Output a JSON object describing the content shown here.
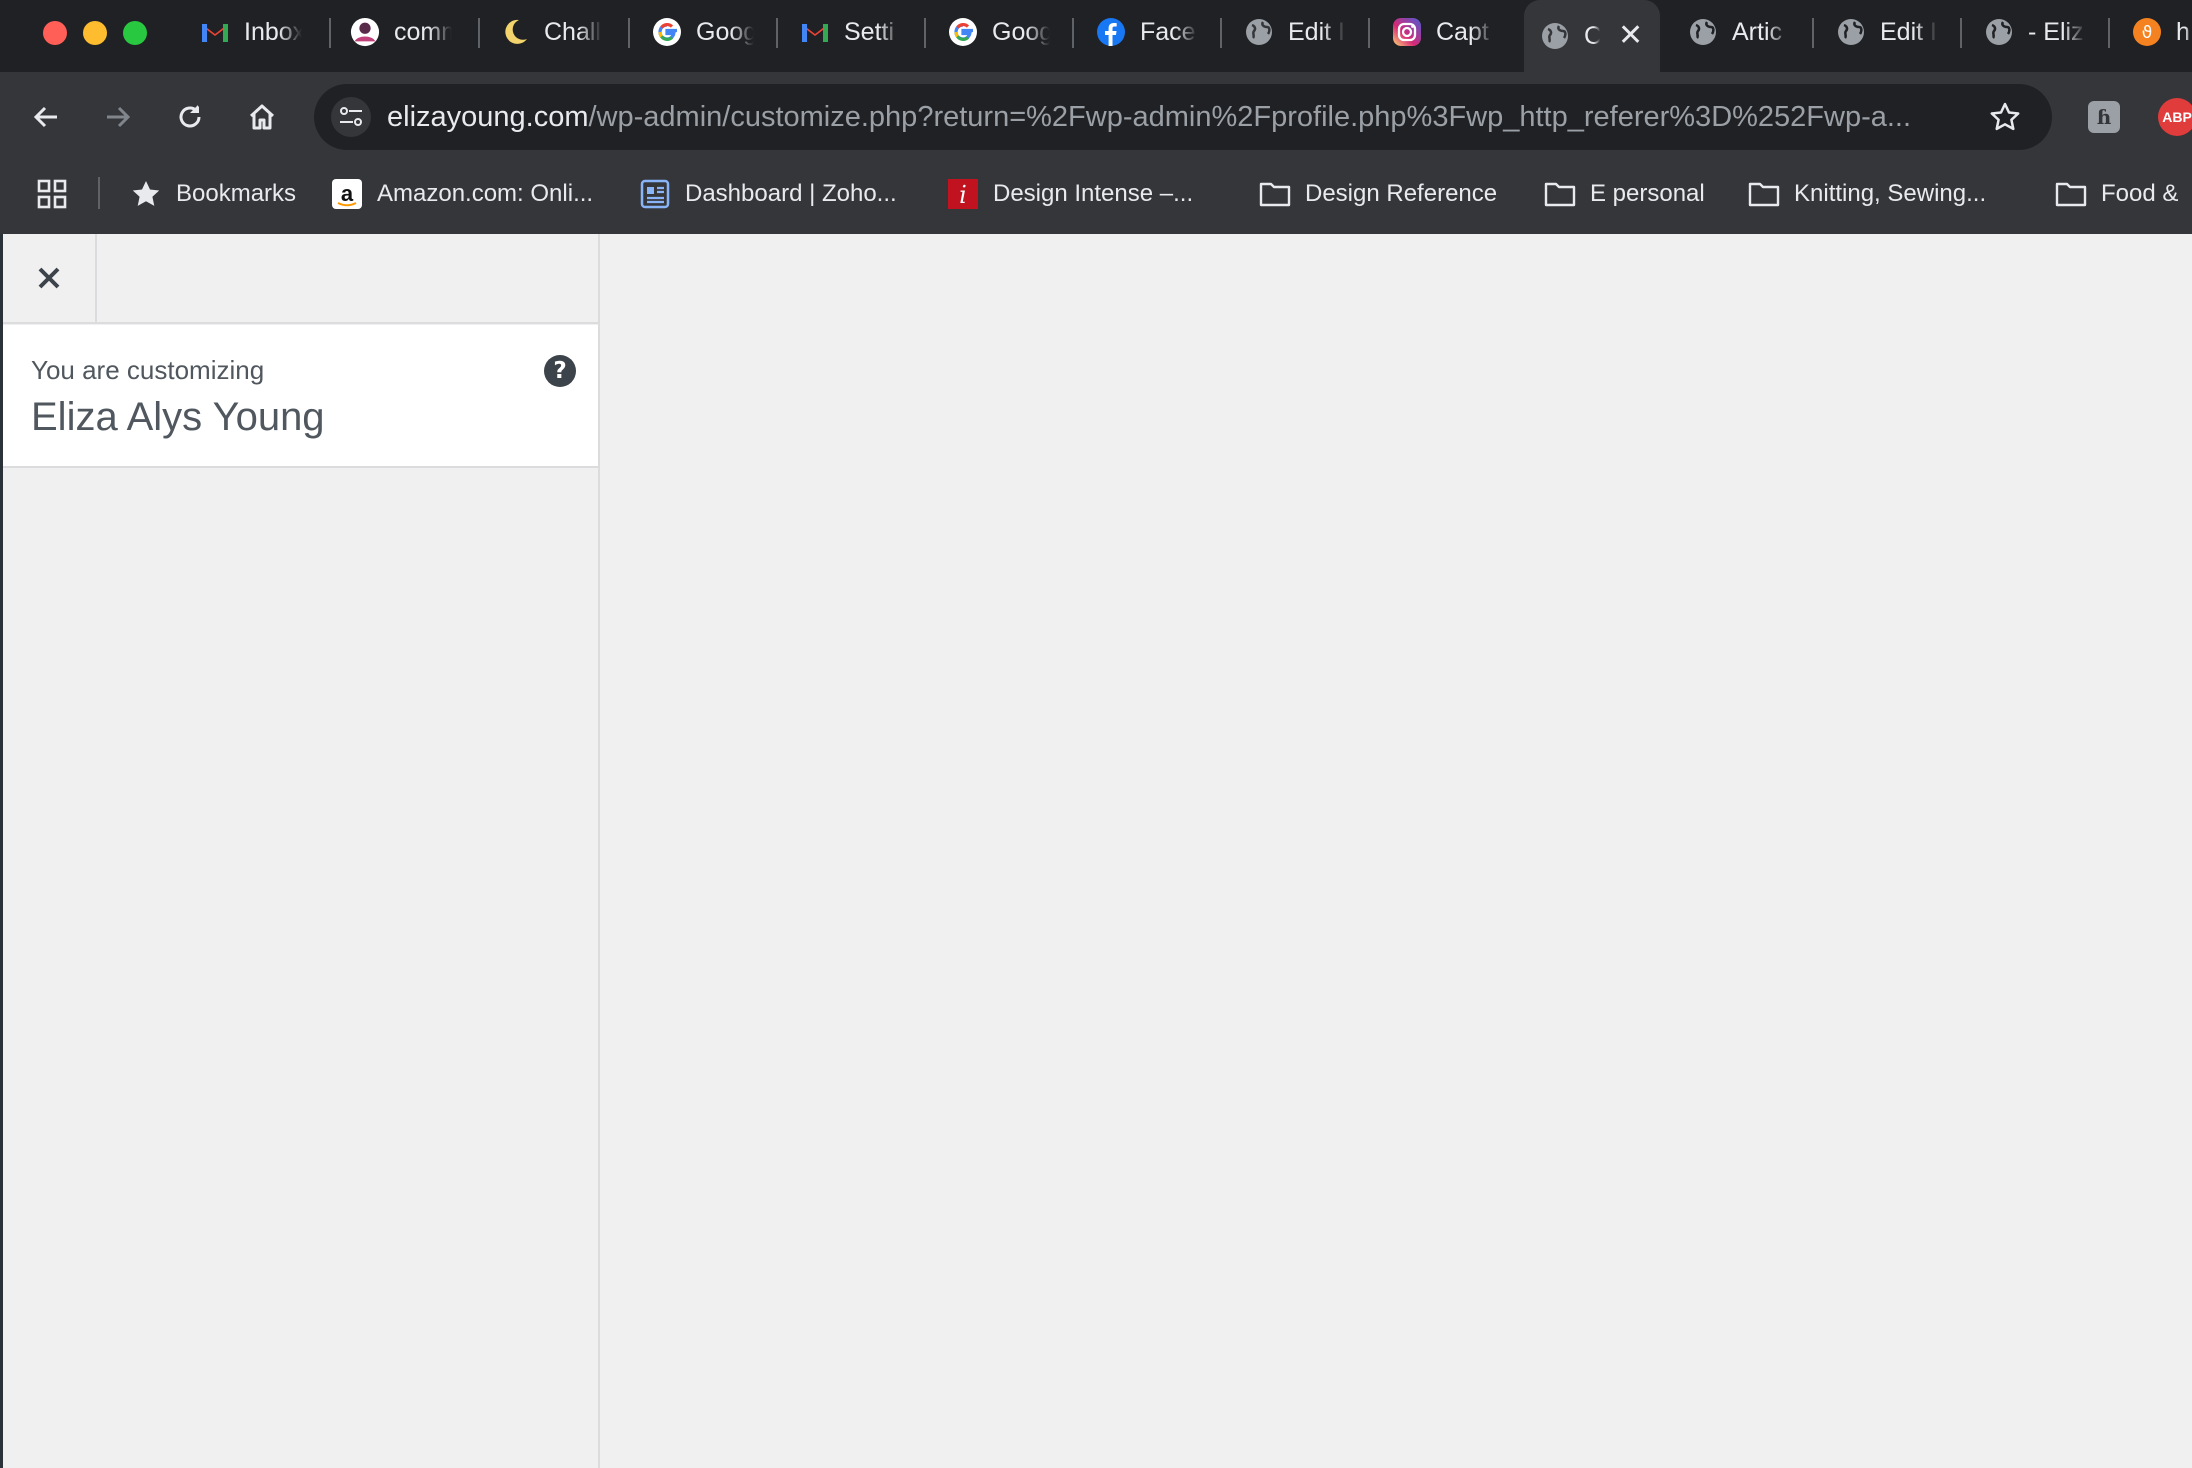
{
  "tabs": [
    {
      "title": "Inbox",
      "icon": "gmail-icon"
    },
    {
      "title": "comm",
      "icon": "avatar-favicon-icon"
    },
    {
      "title": "Chall",
      "icon": "moon-icon"
    },
    {
      "title": "Goog",
      "icon": "google-icon"
    },
    {
      "title": "Setti",
      "icon": "gmail-icon"
    },
    {
      "title": "Goog",
      "icon": "google-icon"
    },
    {
      "title": "Face",
      "icon": "facebook-icon"
    },
    {
      "title": "Edit I",
      "icon": "globe-icon"
    },
    {
      "title": "Capt",
      "icon": "instagram-icon"
    },
    {
      "title": "C",
      "icon": "globe-icon",
      "active": true
    },
    {
      "title": "Artic",
      "icon": "globe-icon"
    },
    {
      "title": "Edit I",
      "icon": "globe-icon"
    },
    {
      "title": "- Eliz",
      "icon": "globe-icon"
    },
    {
      "title": "h",
      "icon": "brave-icon"
    }
  ],
  "address": {
    "host": "elizayoung.com",
    "path": "/wp-admin/customize.php?return=%2Fwp-admin%2Fprofile.php%3Fwp_http_referer%3D%252Fwp-a..."
  },
  "extensions": {
    "ext1_letter": "ɦ",
    "adblock_label": "ABP"
  },
  "bookmarks": [
    {
      "label": "Bookmarks",
      "icon": "star-icon"
    },
    {
      "label": "Amazon.com: Onli...",
      "icon": "amazon-icon"
    },
    {
      "label": "Dashboard | Zoho...",
      "icon": "zoho-icon"
    },
    {
      "label": "Design Intense –...",
      "icon": "design-intense-icon"
    },
    {
      "label": "Design Reference",
      "icon": "folder-icon"
    },
    {
      "label": "E personal",
      "icon": "folder-icon"
    },
    {
      "label": "Knitting, Sewing...",
      "icon": "folder-icon"
    },
    {
      "label": "Food &",
      "icon": "folder-icon"
    }
  ],
  "customizer": {
    "info_action": "You are customizing",
    "site_title": "Eliza Alys Young",
    "help_label": "?"
  },
  "colors": {
    "chrome_dark": "#202124",
    "chrome_toolbar": "#35363a",
    "wp_text": "#50575e",
    "wp_bg": "#f0f0f0"
  }
}
